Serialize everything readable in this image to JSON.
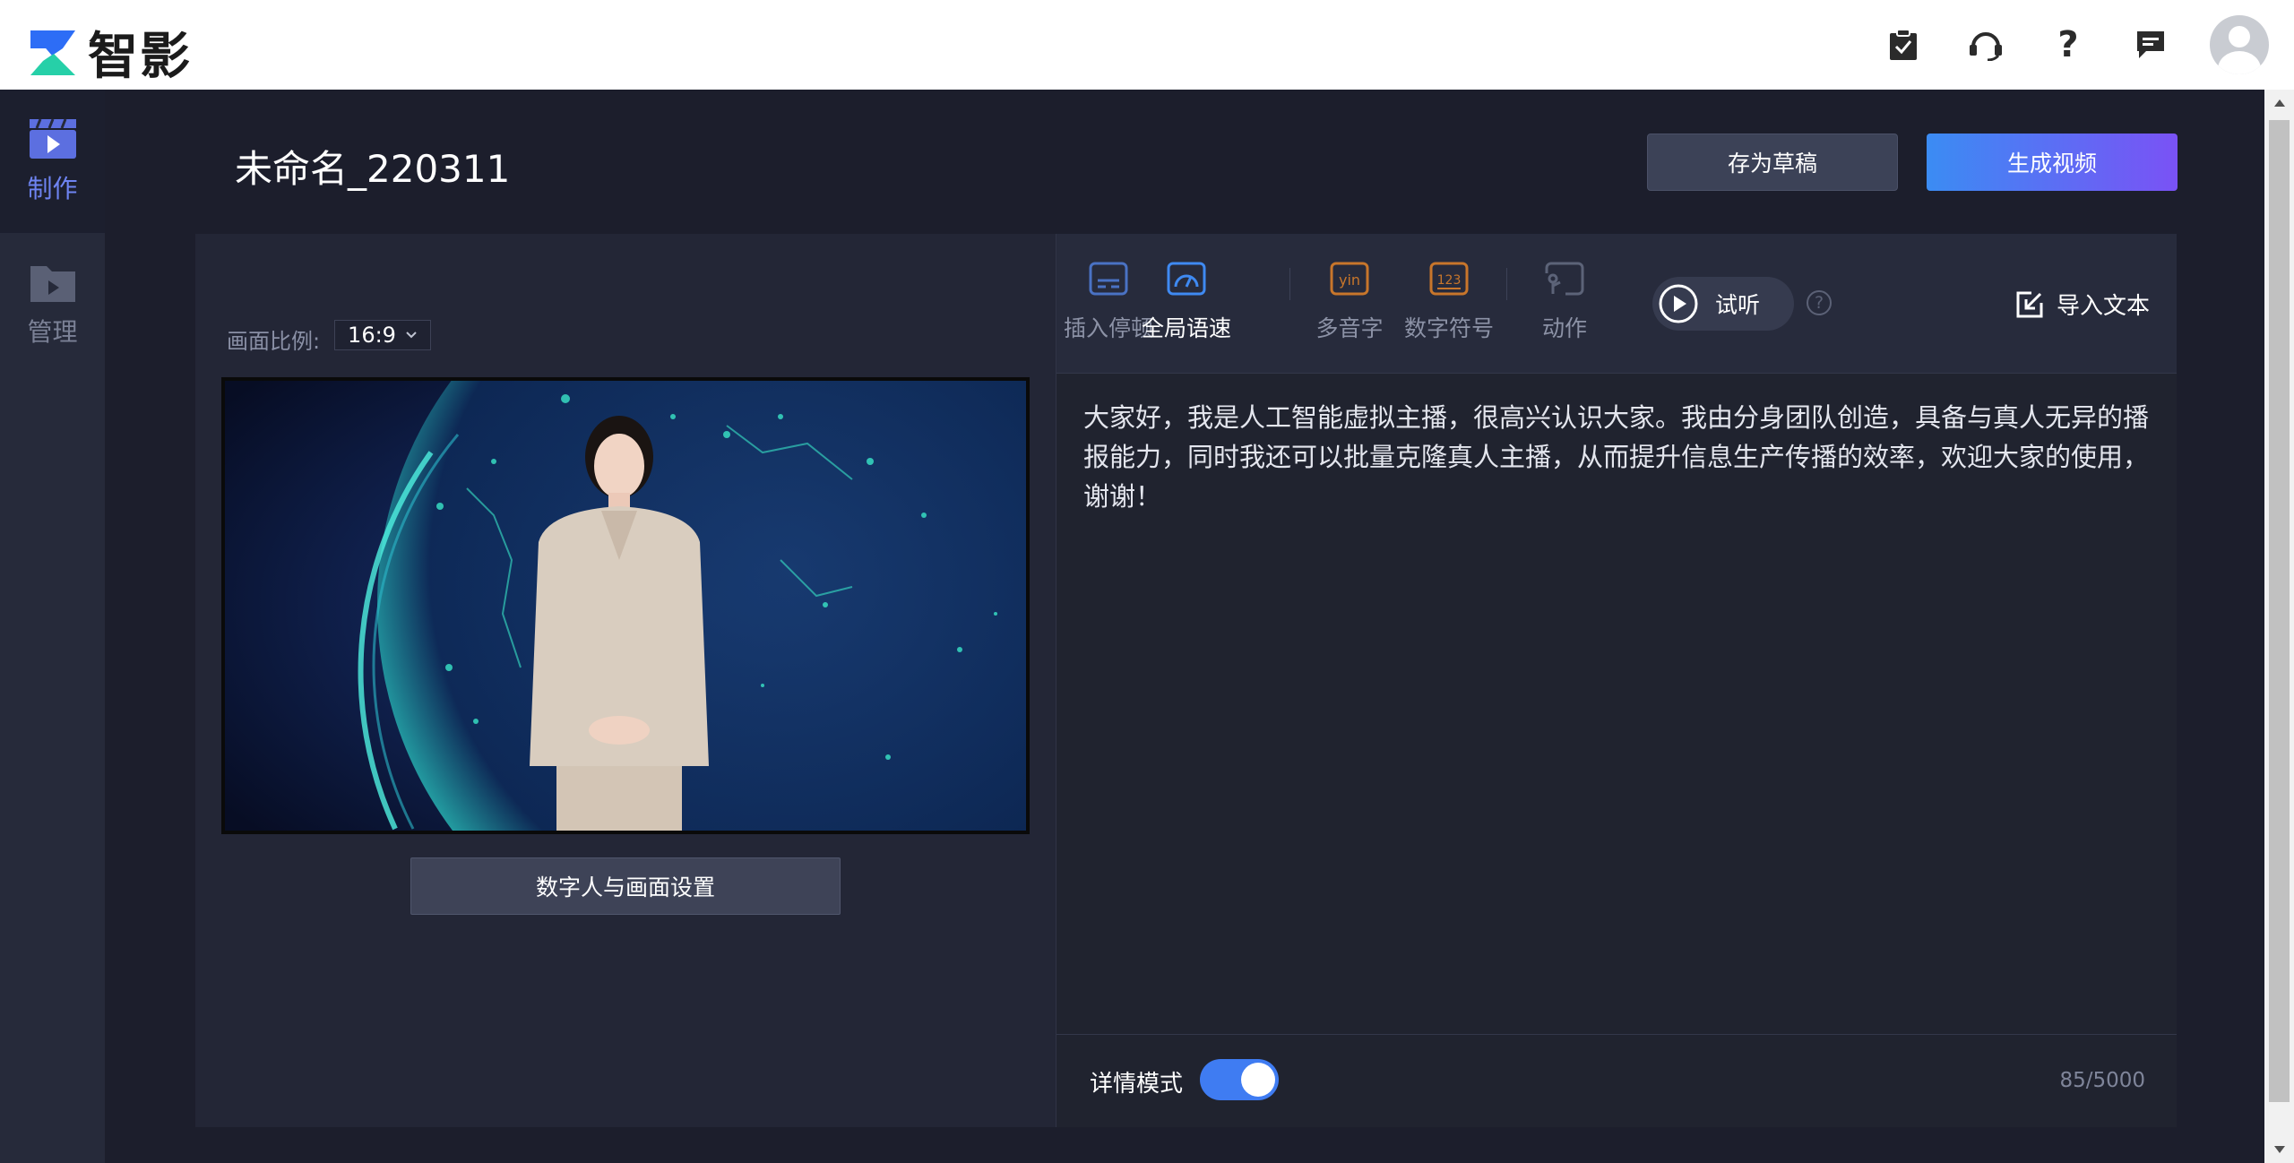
{
  "app": {
    "name": "智影"
  },
  "sidebar": {
    "items": [
      {
        "label": "制作",
        "icon": "video-clapper-icon",
        "active": true
      },
      {
        "label": "管理",
        "icon": "folder-video-icon",
        "active": false
      }
    ]
  },
  "header": {
    "title": "未命名_220311",
    "draft_label": "存为草稿",
    "generate_label": "生成视频"
  },
  "canvas": {
    "ratio_label": "画面比例:",
    "ratio_value": "16:9",
    "settings_label": "数字人与画面设置"
  },
  "toolbar": {
    "tools": [
      {
        "label": "插入停顿",
        "icon": "pause-insert-icon",
        "active": false
      },
      {
        "label": "全局语速",
        "icon": "speedometer-icon",
        "active": true
      },
      {
        "label": "多音字",
        "icon": "pinyin-icon",
        "active": false
      },
      {
        "label": "数字符号",
        "icon": "number-123-icon",
        "active": false
      },
      {
        "label": "动作",
        "icon": "action-icon",
        "active": false
      }
    ],
    "listen_label": "试听",
    "import_label": "导入文本"
  },
  "editor": {
    "text": "大家好，我是人工智能虚拟主播，很高兴认识大家。我由分身团队创造，具备与真人无异的播报能力，同时我还可以批量克隆真人主播，从而提升信息生产传播的效率，欢迎大家的使用，谢谢！",
    "detail_mode_label": "详情模式",
    "detail_mode_on": true,
    "char_count": "85/5000"
  },
  "colors": {
    "accent_blue": "#3f7cf2",
    "gradient_start": "#3b8cf3",
    "gradient_end": "#7a52f5",
    "tool_orange": "#c8762b"
  }
}
